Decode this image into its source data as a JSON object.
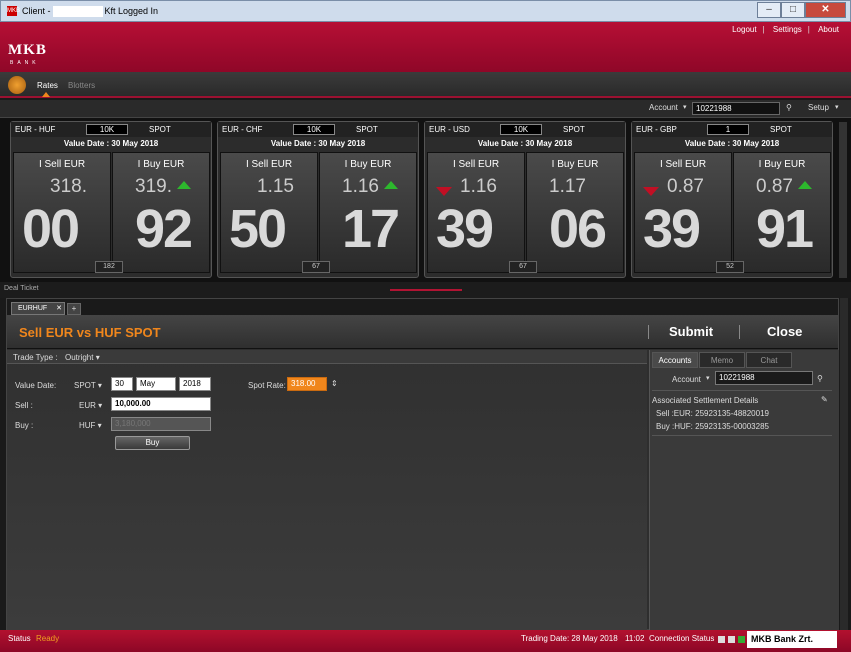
{
  "window": {
    "title_prefix": "Client -",
    "title_suffix": "Kft Logged In",
    "min": "–",
    "max": "□",
    "close": "✕"
  },
  "header": {
    "logo": "MKB",
    "logo_sub": "BANK",
    "links": [
      "Logout",
      "Settings",
      "About"
    ]
  },
  "nav": {
    "tabs": [
      "Rates",
      "Blotters"
    ]
  },
  "toolbar": {
    "account_label": "Account",
    "account_value": "10221988",
    "setup": "Setup"
  },
  "tiles": [
    {
      "pair": "EUR - HUF",
      "amount": "10K",
      "type": "SPOT",
      "value_date": "Value Date : 30 May 2018",
      "sell_label": "I Sell EUR",
      "buy_label": "I Buy EUR",
      "sell_big": "318.",
      "sell_pips": "00",
      "buy_big": "319.",
      "buy_pips": "92",
      "sell_dir": "",
      "buy_dir": "up",
      "vol": "182"
    },
    {
      "pair": "EUR - CHF",
      "amount": "10K",
      "type": "SPOT",
      "value_date": "Value Date : 30 May 2018",
      "sell_label": "I Sell EUR",
      "buy_label": "I Buy EUR",
      "sell_big": "1.15",
      "sell_pips": "50",
      "buy_big": "1.16",
      "buy_pips": "17",
      "sell_dir": "",
      "buy_dir": "up",
      "vol": "67"
    },
    {
      "pair": "EUR - USD",
      "amount": "10K",
      "type": "SPOT",
      "value_date": "Value Date : 30 May 2018",
      "sell_label": "I Sell EUR",
      "buy_label": "I Buy EUR",
      "sell_big": "1.16",
      "sell_pips": "39",
      "buy_big": "1.17",
      "buy_pips": "06",
      "sell_dir": "down",
      "buy_dir": "",
      "vol": "67"
    },
    {
      "pair": "EUR - GBP",
      "amount": "1",
      "type": "SPOT",
      "value_date": "Value Date : 30 May 2018",
      "sell_label": "I Sell EUR",
      "buy_label": "I Buy EUR",
      "sell_big": "0.87",
      "sell_pips": "39",
      "buy_big": "0.87",
      "buy_pips": "91",
      "sell_dir": "down",
      "buy_dir": "up",
      "vol": "52"
    }
  ],
  "deal": {
    "label": "Deal Ticket",
    "tab": "EURHUF",
    "tab_add": "+",
    "title": "Sell EUR vs HUF SPOT",
    "submit": "Submit",
    "close": "Close",
    "trade_type_label": "Trade Type :",
    "trade_type_value": "Outright",
    "value_date_label": "Value Date:",
    "value_date_type": "SPOT",
    "day": "30",
    "month": "May",
    "year": "2018",
    "spot_rate_label": "Spot Rate:",
    "spot_rate": "318.00",
    "sell_label": "Sell :",
    "sell_ccy": "EUR",
    "sell_amount": "10,000.00",
    "buy_label": "Buy :",
    "buy_ccy": "HUF",
    "buy_amount": "3,180,000",
    "buy_button": "Buy"
  },
  "right_panel": {
    "tabs": [
      "Accounts",
      "Memo",
      "Chat"
    ],
    "account_label": "Account",
    "account_value": "10221988",
    "settlement_title": "Associated Settlement Details",
    "sell_line": "Sell :EUR: 25923135-48820019",
    "buy_line": "Buy :HUF: 25923135-00003285"
  },
  "status": {
    "label": "Status",
    "value": "Ready",
    "trading_date": "Trading Date: 28 May 2018",
    "time": "11:02",
    "connection": "Connection Status",
    "company": "MKB Bank Zrt."
  },
  "colors": {
    "brand_red": "#a50d30",
    "accent_orange": "#f0861c",
    "up_green": "#2db82d",
    "down_red": "#c10f24"
  }
}
